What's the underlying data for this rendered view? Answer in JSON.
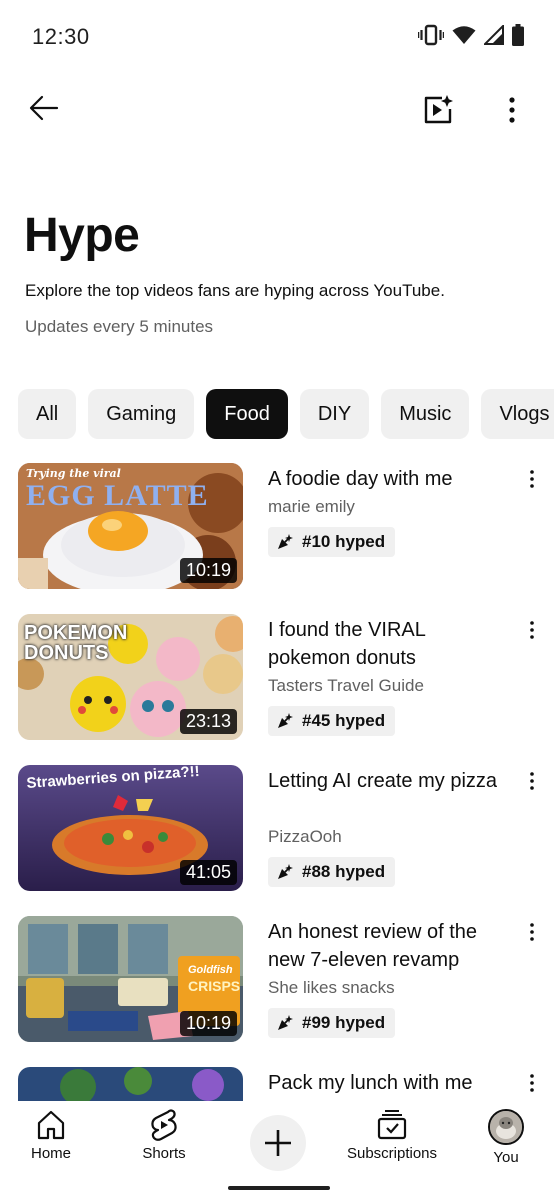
{
  "status_bar": {
    "time": "12:30"
  },
  "page": {
    "title": "Hype",
    "subtitle": "Explore the top videos fans are hyping across YouTube.",
    "update_note": "Updates every 5 minutes"
  },
  "chips": [
    "All",
    "Gaming",
    "Food",
    "DIY",
    "Music",
    "Vlogs"
  ],
  "active_chip": "Food",
  "videos": [
    {
      "title": "A foodie day with me",
      "channel": "marie emily",
      "hype": "#10 hyped",
      "duration": "10:19",
      "thumb_text": "Trying the viral",
      "thumb_text2": "EGG LATTE"
    },
    {
      "title": "I found the VIRAL pokemon donuts",
      "channel": "Tasters Travel Guide",
      "hype": "#45 hyped",
      "duration": "23:13",
      "thumb_text": "POKEMON",
      "thumb_text2": "DONUTS"
    },
    {
      "title": "Letting AI create my pizza",
      "channel": "PizzaOoh",
      "hype": "#88 hyped",
      "duration": "41:05",
      "thumb_text": "Strawberries on pizza?!!"
    },
    {
      "title": "An honest review of the new 7-eleven revamp",
      "channel": "She likes snacks",
      "hype": "#99 hyped",
      "duration": "10:19",
      "thumb_text": "Goldfish",
      "thumb_text2": "CRISPS"
    },
    {
      "title": "Pack my lunch with me"
    }
  ],
  "bottom_nav": {
    "home": "Home",
    "shorts": "Shorts",
    "subscriptions": "Subscriptions",
    "you": "You"
  },
  "colors": {
    "text": "#0f0f0f",
    "secondary_text": "#606060",
    "chip_bg": "#f0f0f0",
    "chip_active_bg": "#0f0f0f"
  }
}
